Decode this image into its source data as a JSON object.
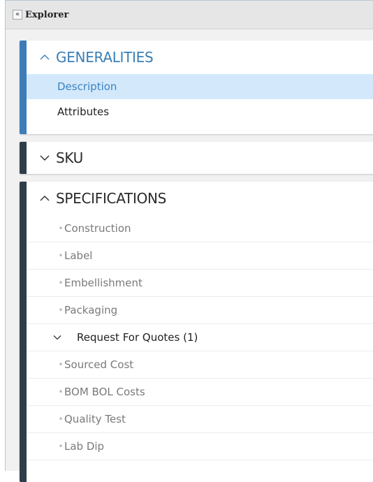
{
  "explorer": {
    "collapse_icon": "double-chevron-left-icon",
    "collapse_glyph": "«",
    "title": "Explorer"
  },
  "colors": {
    "generalities_accent": "#3c7db8",
    "dark_accent": "#2e3c4b",
    "selected_bg": "#d3e9fb",
    "selected_text": "#3b82bf"
  },
  "panels": {
    "generalities": {
      "title": "GENERALITIES",
      "state": "expanded",
      "items": [
        {
          "label": "Description",
          "selected": true
        },
        {
          "label": "Attributes",
          "selected": false
        }
      ]
    },
    "sku": {
      "title": "SKU",
      "state": "collapsed"
    },
    "specifications": {
      "title": "SPECIFICATIONS",
      "state": "expanded",
      "items": [
        {
          "label": "Construction"
        },
        {
          "label": "Label"
        },
        {
          "label": "Embellishment"
        },
        {
          "label": "Packaging"
        },
        {
          "label": "Request For Quotes (1)",
          "expanded": true
        },
        {
          "label": "Sourced Cost"
        },
        {
          "label": "BOM BOL Costs"
        },
        {
          "label": "Quality Test"
        },
        {
          "label": "Lab Dip"
        }
      ]
    }
  }
}
